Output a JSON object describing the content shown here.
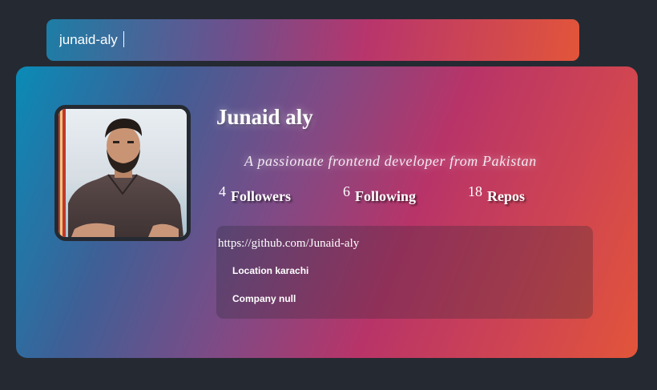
{
  "search": {
    "value": "junaid-aly",
    "caret_visible": true
  },
  "profile": {
    "name": "Junaid aly",
    "bio": "A passionate frontend developer from Pakistan",
    "stats": {
      "followers": {
        "count": "4",
        "label": "Followers"
      },
      "following": {
        "count": "6",
        "label": "Following"
      },
      "repos": {
        "count": "18",
        "label": "Repos"
      }
    },
    "link": "https://github.com/Junaid-aly",
    "location_text": "Location karachi",
    "company_text": "Company null"
  },
  "colors": {
    "page_background": "#252a32",
    "gradient_start": "#0a8bb6",
    "gradient_mid": "#b83468",
    "gradient_end": "#e2553a"
  },
  "icons": {
    "avatar": "profile-photo"
  }
}
